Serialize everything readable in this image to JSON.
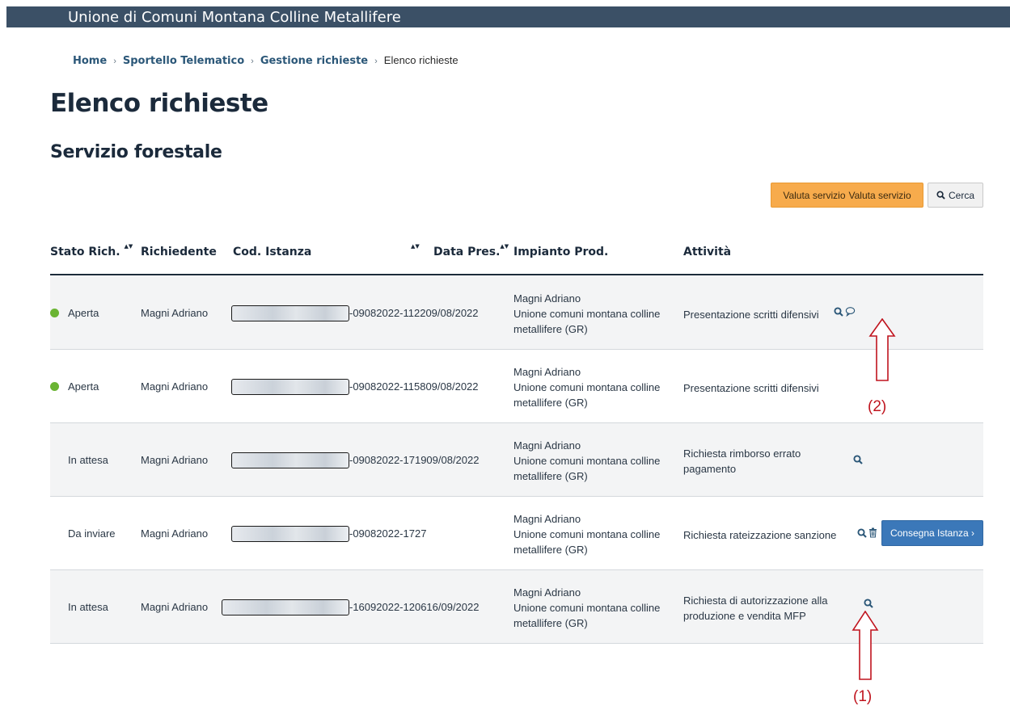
{
  "header": {
    "site_title": "Unione di Comuni Montana Colline Metallifere"
  },
  "breadcrumb": {
    "items": [
      {
        "label": "Home"
      },
      {
        "label": "Sportello Telematico"
      },
      {
        "label": "Gestione richieste"
      }
    ],
    "current": "Elenco richieste",
    "separator": "›"
  },
  "page": {
    "title": "Elenco richieste",
    "section": "Servizio forestale"
  },
  "toolbar": {
    "valuta_label_1": "Valuta servizio",
    "valuta_label_2": "Valuta servizio",
    "cerca_label": "Cerca"
  },
  "table": {
    "columns": {
      "stato": "Stato Rich.",
      "richiedente": "Richiedente",
      "codice": "Cod. Istanza",
      "data": "Data Pres.",
      "impianto": "Impianto Prod.",
      "attivita": "Attività"
    },
    "rows": [
      {
        "status": "Aperta",
        "status_color": "#6ab433",
        "richiedente": "Magni Adriano",
        "code": "-09082022-112209/08/2022",
        "impianto_1": "Magni Adriano",
        "impianto_2": "Unione comuni montana colline metallifere (GR)",
        "attivita": "Presentazione scritti difensivi"
      },
      {
        "status": "Aperta",
        "status_color": "#6ab433",
        "richiedente": "Magni Adriano",
        "code": "-09082022-115809/08/2022",
        "impianto_1": "Magni Adriano",
        "impianto_2": "Unione comuni montana colline metallifere (GR)",
        "attivita": "Presentazione scritti difensivi"
      },
      {
        "status": "In attesa",
        "richiedente": "Magni Adriano",
        "code": "-09082022-171909/08/2022",
        "impianto_1": "Magni Adriano",
        "impianto_2": "Unione comuni montana colline metallifere (GR)",
        "attivita": "Richiesta rimborso errato pagamento"
      },
      {
        "status": "Da inviare",
        "richiedente": "Magni Adriano",
        "code": "-09082022-1727",
        "impianto_1": "Magni Adriano",
        "impianto_2": "Unione comuni montana colline metallifere (GR)",
        "attivita": "Richiesta rateizzazione sanzione",
        "action_label": "Consegna Istanza ›"
      },
      {
        "status": "In attesa",
        "richiedente": "Magni Adriano",
        "code": "-16092022-120616/09/2022",
        "impianto_1": "Magni Adriano",
        "impianto_2": "Unione comuni montana colline metallifere (GR)",
        "attivita": "Richiesta di autorizzazione alla produzione e vendita MFP"
      }
    ]
  },
  "annotations": {
    "label_1": "(1)",
    "label_2": "(2)",
    "color": "#c0141e"
  },
  "colors": {
    "topbar": "#3b5066",
    "link": "#2b5778",
    "warning_button": "#f7ab4c",
    "primary_button": "#3b78b9"
  },
  "icons": [
    "search-icon",
    "comment-icon",
    "trash-icon",
    "sort-icon",
    "up-arrow-icon"
  ]
}
